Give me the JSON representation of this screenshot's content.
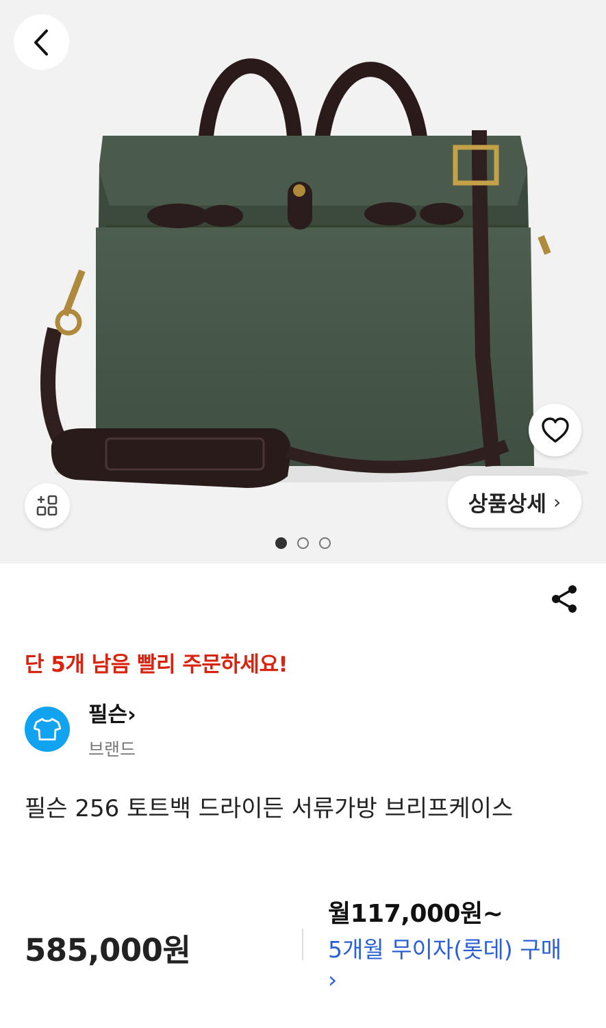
{
  "header": {
    "back_icon": "chevron-left-icon"
  },
  "hero": {
    "image": "green canvas briefcase with leather handles and shoulder strap",
    "wishlist_icon": "heart-outline-icon",
    "grid_icon": "grid-plus-icon",
    "detail_button_label": "상품상세",
    "detail_button_chevron": "›",
    "carousel": {
      "total": 3,
      "active_index": 0
    }
  },
  "actions": {
    "share_icon": "share-icon"
  },
  "stock_notice": "단 5개 남음 빨리 주문하세요!",
  "brand": {
    "name": "필슨",
    "chevron": "›",
    "label": "브랜드",
    "logo_icon": "tshirt-icon",
    "logo_color": "#11a3ef"
  },
  "product": {
    "title": "필슨 256 토트백 드라이든 서류가방 브리프케이스",
    "price": "585,000원"
  },
  "installment": {
    "monthly": "월117,000원~",
    "info": "5개월 무이자(롯데) 구매",
    "chevron": "›"
  },
  "colors": {
    "stock_notice": "#d9230f",
    "link": "#2a5fd6",
    "hero_bg": "#f2f2f2"
  }
}
